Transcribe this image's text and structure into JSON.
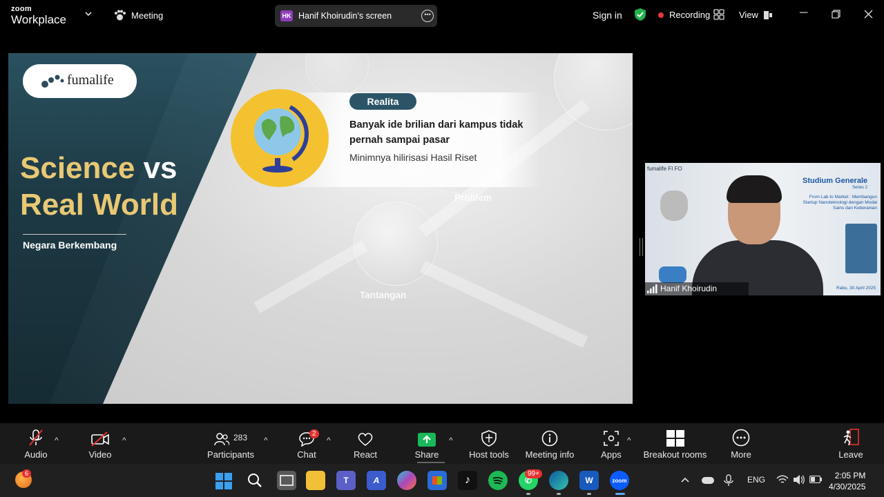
{
  "app": {
    "brand_top": "zoom",
    "brand_bottom": "Workplace",
    "meeting_label": "Meeting"
  },
  "share": {
    "initials": "HK",
    "label": "Hanif Khoirudin's screen"
  },
  "header": {
    "sign_in": "Sign in",
    "recording": "Recording",
    "view": "View"
  },
  "slide": {
    "logo": "fumalife",
    "title_line1": "Science",
    "title_vs": "vs",
    "title_line2": "Real World",
    "subtitle": "Negara Berkembang",
    "tag": "Realita",
    "headline": "Banyak ide brilian dari kampus tidak pernah sampai pasar",
    "subtext": "Minimnya hilirisasi Hasil Riset",
    "problem": "Problem",
    "tantangan": "Tantangan"
  },
  "video": {
    "name": "Hanif Khoirudin",
    "logos": "fumalife  FI  FO",
    "banner_title": "Studium Generale",
    "banner_series": "Series 2",
    "banner_desc": "From Lab to Market : Membangun Startup Nanoteknologi dengan Modal Sains dan Keberanian",
    "banner_date": "Rabu, 30 April 2025"
  },
  "toolbar": {
    "audio": "Audio",
    "video": "Video",
    "participants_count": "283",
    "participants": "Participants",
    "chat_badge": "2",
    "chat": "Chat",
    "react": "React",
    "share": "Share",
    "host_tools": "Host tools",
    "meeting_info": "Meeting info",
    "apps": "Apps",
    "breakout": "Breakout rooms",
    "more": "More",
    "leave": "Leave"
  },
  "taskbar": {
    "weather_badge": "6",
    "whatsapp_badge": "99+",
    "lang": "ENG",
    "time": "2:05 PM",
    "date": "4/30/2025"
  },
  "colors": {
    "accent_gold": "#e9c874",
    "slide_tag": "#2b5567",
    "record_red": "#e8363c",
    "share_green": "#19b85a"
  }
}
